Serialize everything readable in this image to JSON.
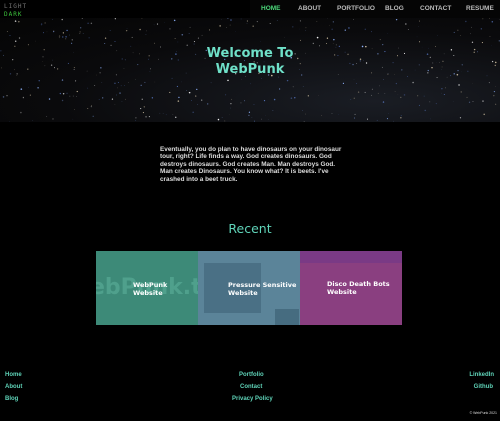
{
  "theme": {
    "light": "LIGHT",
    "dark": "DARK"
  },
  "nav": {
    "items": [
      "HOME",
      "ABOUT",
      "PORTFOLIO",
      "BLOG",
      "CONTACT",
      "RESUME"
    ],
    "active": "HOME",
    "active_color": "#4cd97b"
  },
  "hero": {
    "line1": "Welcome To",
    "line2": "WebPunk"
  },
  "intro": "Eventually, you do plan to have dinosaurs on your dinosaur tour, right? Life finds a way. God creates dinosaurs. God destroys dinosaurs. God creates Man. Man destroys God. Man creates Dinosaurs. You know what? It is beets. I've crashed into a beet truck.",
  "recent": {
    "title": "Recent",
    "cards": [
      {
        "line1": "WebPunk",
        "line2": "Website",
        "color": "#3d8a78"
      },
      {
        "line1": "Pressure Sensitive",
        "line2": "Website",
        "color": "#5b8499"
      },
      {
        "line1": "Disco Death Bots",
        "line2": "Website",
        "color": "#8a3f80"
      }
    ]
  },
  "footer": {
    "left": [
      "Home",
      "About",
      "Blog"
    ],
    "center": [
      "Portfolio",
      "Contact",
      "Privacy Policy"
    ],
    "right": [
      "LinkedIn",
      "Github"
    ],
    "copyright": "© WebPunk 2021"
  }
}
